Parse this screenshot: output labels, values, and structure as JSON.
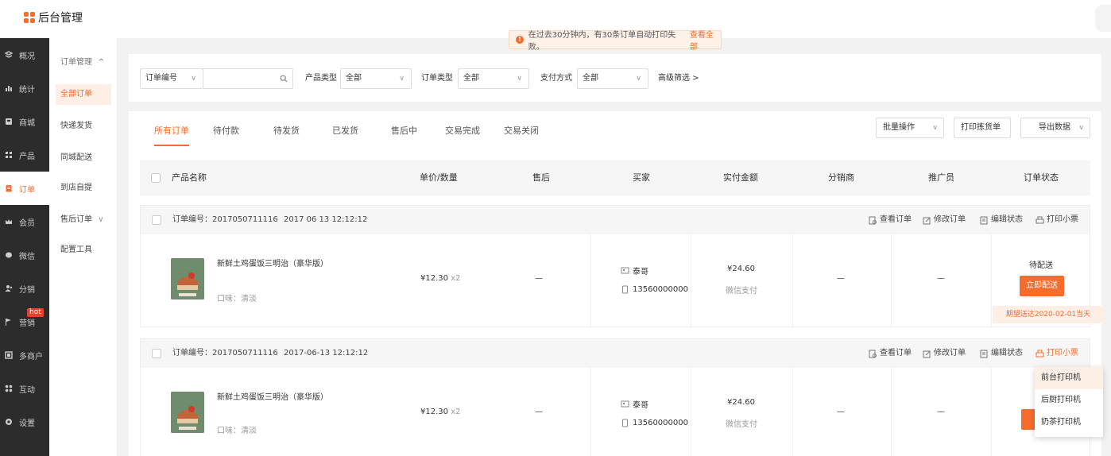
{
  "app": {
    "title": "后台管理"
  },
  "sidebar": {
    "items": [
      {
        "label": "概况",
        "icon": "overview-icon"
      },
      {
        "label": "统计",
        "icon": "stats-icon"
      },
      {
        "label": "商城",
        "icon": "mall-icon"
      },
      {
        "label": "产品",
        "icon": "product-icon"
      },
      {
        "label": "订单",
        "icon": "order-icon",
        "active": true
      },
      {
        "label": "会员",
        "icon": "crown-icon"
      },
      {
        "label": "微信",
        "icon": "wechat-icon"
      },
      {
        "label": "分销",
        "icon": "distribution-icon"
      },
      {
        "label": "营销",
        "icon": "flag-icon",
        "badge": "hot"
      },
      {
        "label": "多商户",
        "icon": "merchant-icon"
      },
      {
        "label": "互动",
        "icon": "interact-icon"
      },
      {
        "label": "设置",
        "icon": "gear-icon"
      }
    ]
  },
  "subnav": {
    "group1": "订单管理",
    "items": [
      "全部订单",
      "快递发货",
      "同城配送",
      "到店自提"
    ],
    "group2": "售后订单",
    "tools": "配置工具"
  },
  "toast": {
    "text": "在过去30分钟内，有30条订单自动打印失败。",
    "link": "查看全部"
  },
  "filters": {
    "order_field": "订单编号",
    "search_value": "",
    "product_type_label": "产品类型",
    "product_type_value": "全部",
    "order_type_label": "订单类型",
    "order_type_value": "全部",
    "pay_label": "支付方式",
    "pay_value": "全部",
    "advanced": "高级筛选 >"
  },
  "tabs": [
    "所有订单",
    "待付款",
    "待发货",
    "已发货",
    "售后中",
    "交易完成",
    "交易关闭"
  ],
  "tools": {
    "batch": "批量操作",
    "print_picklist": "打印拣货单",
    "export": "导出数据"
  },
  "table": {
    "headers": [
      "产品名称",
      "单价/数量",
      "售后",
      "买家",
      "实付金额",
      "分销商",
      "推广员",
      "订单状态"
    ]
  },
  "orders": [
    {
      "no_label": "订单编号：2017050711116",
      "time": "2017 06 13 12:12:12",
      "actions": [
        "查看订单",
        "修改订单",
        "编辑状态",
        "打印小票"
      ],
      "product_name": "新鲜土鸡蛋饭三明治（豪华版）",
      "flavor": "口味：清淡",
      "price": "¥12.30",
      "qty": "x2",
      "after_sale": "—",
      "buyer": "泰哥",
      "phone": "13560000000",
      "amount": "¥24.60",
      "pay_method": "微信支付",
      "distributor": "—",
      "promoter": "—",
      "status": "待配送",
      "cta": "立即配送",
      "deadline": "期望送达2020-02-01当天"
    },
    {
      "no_label": "订单编号：2017050711116",
      "time": "2017-06-13 12:12:12",
      "actions": [
        "查看订单",
        "修改订单",
        "编辑状态",
        "打印小票"
      ],
      "product_name": "新鲜土鸡蛋饭三明治（豪华版）",
      "flavor": "口味：清淡",
      "price": "¥12.30",
      "qty": "x2",
      "after_sale": "—",
      "buyer": "泰哥",
      "phone": "13560000000",
      "amount": "¥24.60",
      "pay_method": "微信支付",
      "distributor": "—",
      "promoter": "—"
    }
  ],
  "print_menu": [
    "前台打印机",
    "后厨打印机",
    "奶茶打印机"
  ],
  "colors": {
    "accent": "#f56c2d",
    "sidebar": "#2c2c2c"
  }
}
